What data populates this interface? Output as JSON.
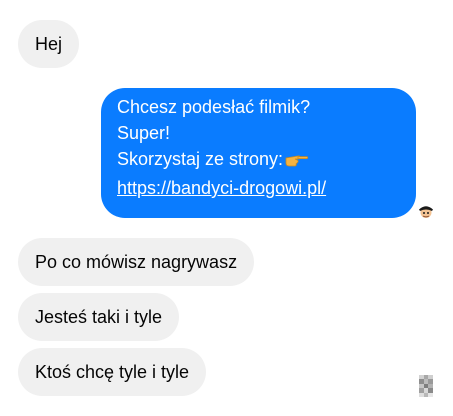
{
  "messages": {
    "first": {
      "text": "Hej"
    },
    "outgoing": {
      "line1": "Chcesz podesłać filmik?",
      "line2": "Super!",
      "line3": "Skorzystaj ze strony:",
      "link": "https://bandyci-drogowi.pl/"
    },
    "reply1": {
      "text": "Po co mówisz nagrywasz"
    },
    "reply2": {
      "text": "Jesteś taki i tyle"
    },
    "reply3": {
      "text": "Ktoś chcę tyle i tyle"
    }
  },
  "colors": {
    "incoming_bubble": "#f0f0f0",
    "outgoing_bubble": "#0a7cff",
    "text_dark": "#050505",
    "text_light": "#ffffff"
  },
  "icons": {
    "pointing": "pointing-right-hand-emoji",
    "sender_avatar": "pirate-avatar",
    "seen_avatar": "pixelated-avatar"
  }
}
